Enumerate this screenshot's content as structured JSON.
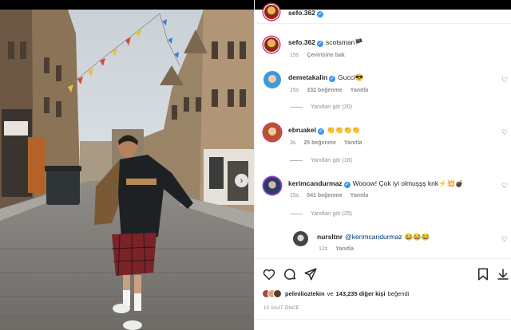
{
  "post": {
    "author": "sefo.362",
    "caption_author": "sefo.362",
    "caption_text": "scotsman🏴",
    "caption_time": "15s",
    "caption_translate": "Çevirisine bak",
    "likes_prefix": "pelinilioztekin",
    "likes_middle": "ve",
    "likes_count": "143,235 diğer kişi",
    "likes_suffix": "beğendi",
    "time_ago": "15 SAAT ÖNCE"
  },
  "comments": [
    {
      "username": "demetakalin",
      "text": "Gucci😎",
      "time": "15s",
      "likes": "332 beğenme",
      "reply": "Yanıtla",
      "view_replies": "Yanıtları gör (20)"
    },
    {
      "username": "ebruakel",
      "text": "👏👏👏👏",
      "time": "3s",
      "likes": "25 beğenme",
      "reply": "Yanıtla",
      "view_replies": "Yanıtları gör (18)"
    },
    {
      "username": "kerimcandurmaz",
      "text": "Wooow! Çok iyi olmuşşş knk⚡💥💣",
      "time": "15s",
      "likes": "541 beğenme",
      "reply": "Yanıtla",
      "view_replies": "Yanıtları gör (25)"
    }
  ],
  "reply_comment": {
    "username": "nursltnr",
    "mention": "@kerimcandurmaz",
    "text": "😂😂😂",
    "time": "12s",
    "reply": "Yanıtla"
  },
  "colors": {
    "verified": "#3897f0",
    "mention": "#00376b",
    "meta": "#8e8e8e"
  }
}
